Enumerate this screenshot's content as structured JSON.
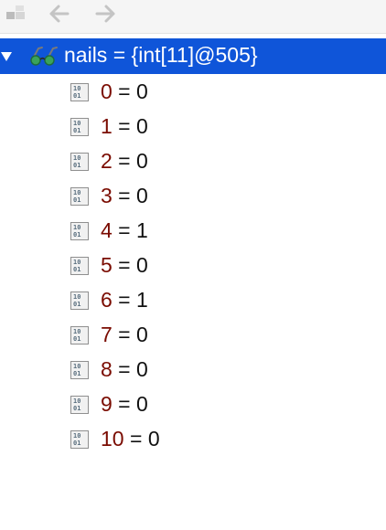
{
  "toolbar": {
    "buttons": [
      {
        "name": "restore-layout-icon"
      },
      {
        "name": "back-arrow-icon"
      },
      {
        "name": "forward-arrow-icon"
      }
    ]
  },
  "variable": {
    "icon": "glasses-icon",
    "name": "nails",
    "equals": " = ",
    "value": "{int[11]@505}",
    "expanded": true,
    "elements": [
      {
        "index": "0",
        "value": "0"
      },
      {
        "index": "1",
        "value": "0"
      },
      {
        "index": "2",
        "value": "0"
      },
      {
        "index": "3",
        "value": "0"
      },
      {
        "index": "4",
        "value": "1"
      },
      {
        "index": "5",
        "value": "0"
      },
      {
        "index": "6",
        "value": "1"
      },
      {
        "index": "7",
        "value": "0"
      },
      {
        "index": "8",
        "value": "0"
      },
      {
        "index": "9",
        "value": "0"
      },
      {
        "index": "10",
        "value": "0"
      }
    ]
  },
  "colors": {
    "selection": "#0f55d9",
    "index": "#7a0b00",
    "value": "#111111"
  }
}
